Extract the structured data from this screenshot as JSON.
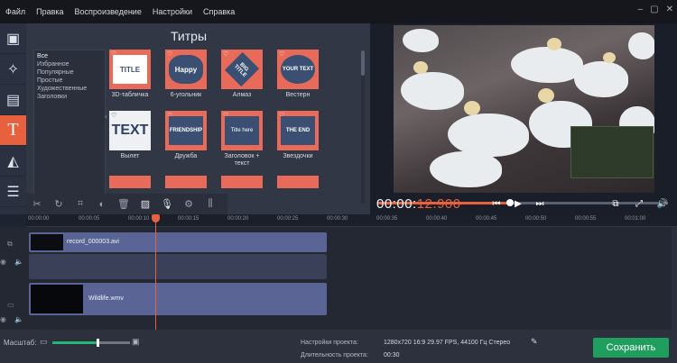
{
  "menu": {
    "file": "Файл",
    "edit": "Правка",
    "playback": "Воспроизведение",
    "settings": "Настройки",
    "help": "Справка"
  },
  "titles_panel": {
    "heading": "Титры",
    "categories": [
      "Все",
      "Избранное",
      "Популярные",
      "Простые",
      "Художественные",
      "Заголовки"
    ],
    "tiles": [
      {
        "label": "3D-табличка",
        "thumb": "TITLE"
      },
      {
        "label": "6-угольник",
        "thumb": "Happy"
      },
      {
        "label": "Алмаз",
        "thumb": "BIG TITLE"
      },
      {
        "label": "Вестерн",
        "thumb": "YOUR TEXT"
      },
      {
        "label": "Вылет",
        "thumb": "TEXT"
      },
      {
        "label": "Дружба",
        "thumb": "FRIENDSHIP"
      },
      {
        "label": "Заголовок + текст",
        "thumb": "Title here"
      },
      {
        "label": "Звездочки",
        "thumb": "THE END"
      }
    ]
  },
  "player": {
    "timecode_main": "00:00:",
    "timecode_rest": "12.900",
    "progress": 0.46
  },
  "ruler": [
    "00:00:00",
    "00:00:05",
    "00:00:10",
    "00:00:15",
    "00:00:20",
    "00:00:25",
    "00:00:30",
    "00:00:35",
    "00:00:40",
    "00:00:45",
    "00:00:50",
    "00:00:55",
    "00:01:00"
  ],
  "tracks": {
    "clip1": "record_000003.avi",
    "clip2": "Wildlife.wmv"
  },
  "bottom": {
    "zoom_label": "Масштаб:",
    "zoom_level": 0.58,
    "settings_key": "Настройки проекта:",
    "settings_value": "1280x720 16:9 29.97 FPS, 44100 Гц Стерео",
    "duration_key": "Длительность проекта:",
    "duration_value": "00:30",
    "save_label": "Сохранить"
  },
  "colors": {
    "accent": "#e8613e",
    "save": "#1f9e5e",
    "clip": "#5a6596"
  }
}
